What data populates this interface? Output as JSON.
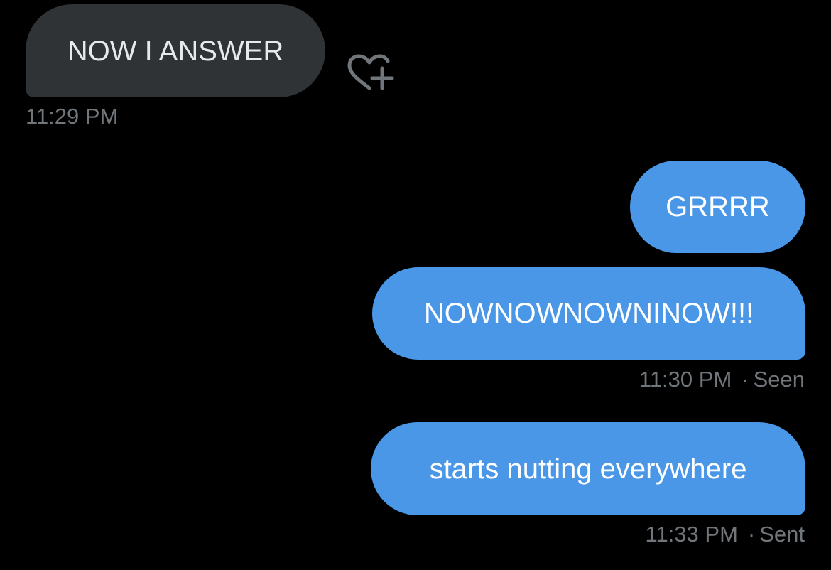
{
  "messages": [
    {
      "direction": "incoming",
      "text": "NOW I ANSWER",
      "time": "11:29 PM"
    },
    {
      "direction": "outgoing",
      "text": "GRRRR"
    },
    {
      "direction": "outgoing",
      "text": "NOWNOWNOWNINOW!!!",
      "time": "11:30 PM",
      "status": "Seen"
    },
    {
      "direction": "outgoing",
      "text": "starts nutting everywhere",
      "time": "11:33 PM",
      "status": "Sent"
    }
  ],
  "separator": "·",
  "icons": {
    "react": "heart-plus-icon"
  },
  "colors": {
    "background": "#000000",
    "incoming_bubble": "#2f3336",
    "outgoing_bubble": "#4a97e8",
    "meta_text": "#71767b",
    "icon": "#71767b"
  }
}
